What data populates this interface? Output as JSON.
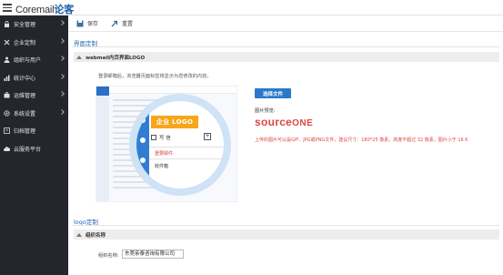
{
  "app": {
    "brand_latin": "Coremail",
    "brand_cjk": "论客"
  },
  "sidebar": {
    "items": [
      {
        "label": "安全管理",
        "icon": "lock-icon",
        "has_submenu": true
      },
      {
        "label": "企业定制",
        "icon": "tools-icon",
        "has_submenu": true
      },
      {
        "label": "组织与用户",
        "icon": "users-icon",
        "has_submenu": true
      },
      {
        "label": "统计中心",
        "icon": "bar-chart-icon",
        "has_submenu": true
      },
      {
        "label": "运维管理",
        "icon": "briefcase-icon",
        "has_submenu": true
      },
      {
        "label": "系统设置",
        "icon": "gear-icon",
        "has_submenu": true
      },
      {
        "label": "归档管理",
        "icon": "archive-icon",
        "has_submenu": false
      },
      {
        "label": "云服务平台",
        "icon": "cloud-icon",
        "has_submenu": false
      }
    ]
  },
  "toolbar": {
    "save_label": "保存",
    "reset_label": "重置"
  },
  "interface": {
    "section_title": "界面定制",
    "subheader": "webmail内页界面LOGO",
    "hint": "登录邮箱后，浏览器页面标签将显示为您修改的内容。",
    "preview": {
      "logo_text": "企业 LOGO",
      "write_label": "写 信",
      "plus": "+",
      "menu_item_1": "重要邮件",
      "menu_item_2": "收件箱"
    },
    "choose_button": "选择文件",
    "preview_label": "图片预览:",
    "logo_source": "source",
    "logo_one": "ONE",
    "warning": "上传的图片可以是GIF、JPG或PNG文件，建议尺寸：180*25 像素，高度不超过 32 像素，图片小于 16 K"
  },
  "logo_section": {
    "section_title": "logo定制",
    "subheader": "组织名称",
    "org_label": "组织名称:",
    "org_value": "东莞亲泰咨询有限公司"
  },
  "colors": {
    "sidebar_bg": "#23272d",
    "accent_blue": "#2b79c9",
    "warning_red": "#e0463b",
    "logo_orange": "#f7a619"
  }
}
